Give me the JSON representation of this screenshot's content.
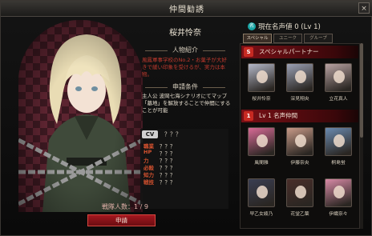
{
  "window": {
    "title": "仲間勧誘",
    "close_glyph": "×"
  },
  "character": {
    "name": "桜井怜奈",
    "profile_heading": "人物紹介",
    "profile_text": "風鳳軍事学校のNo.2・お菓子が大好きで緩い印象を受けるが、実力は本物。",
    "requirements_heading": "申請条件",
    "requirements_text": "主人公 波岡七海シナリオにてマップ「墓地」を解放することで仲間にすることが可能",
    "cv_badge": "CV",
    "cv_value": "？？？",
    "stats": [
      {
        "label": "職業",
        "value": "？？？"
      },
      {
        "label": "HP",
        "value": "？？？"
      },
      {
        "label": "力",
        "value": "？？？"
      },
      {
        "label": "必殺",
        "value": "？？？"
      },
      {
        "label": "知力",
        "value": "？？？"
      },
      {
        "label": "戦技",
        "value": "？？？"
      }
    ],
    "team_count": "戦隊人数：1 / 9",
    "apply_button": "申請"
  },
  "fame": {
    "icon_text": "名",
    "label": "現在名声値 0 (Lv 1)"
  },
  "tabs": [
    {
      "label": "スペシャル",
      "active": true
    },
    {
      "label": "ユニーク",
      "active": false
    },
    {
      "label": "グループ",
      "active": false
    }
  ],
  "special": {
    "badge": "S",
    "title": "スペシャルパートナー",
    "members": [
      {
        "name": "桜井怜奈",
        "color": "#b4b8c8"
      },
      {
        "name": "深見翔央",
        "color": "#9aa0b4"
      },
      {
        "name": "立花真人",
        "color": "#b8a2a2"
      }
    ]
  },
  "lv1": {
    "badge": "1",
    "title": "Lv 1 名声仲間",
    "members": [
      {
        "name": "風間雅",
        "color": "#d86a96"
      },
      {
        "name": "伊藤奈央",
        "color": "#c89a88"
      },
      {
        "name": "桐島蛍",
        "color": "#6a8ab0"
      },
      {
        "name": "早乙女綾乃",
        "color": "#3a3e52"
      },
      {
        "name": "花堂乙葉",
        "color": "#4a2e2a"
      },
      {
        "name": "伊織奈々",
        "color": "#d88aa6"
      }
    ]
  }
}
